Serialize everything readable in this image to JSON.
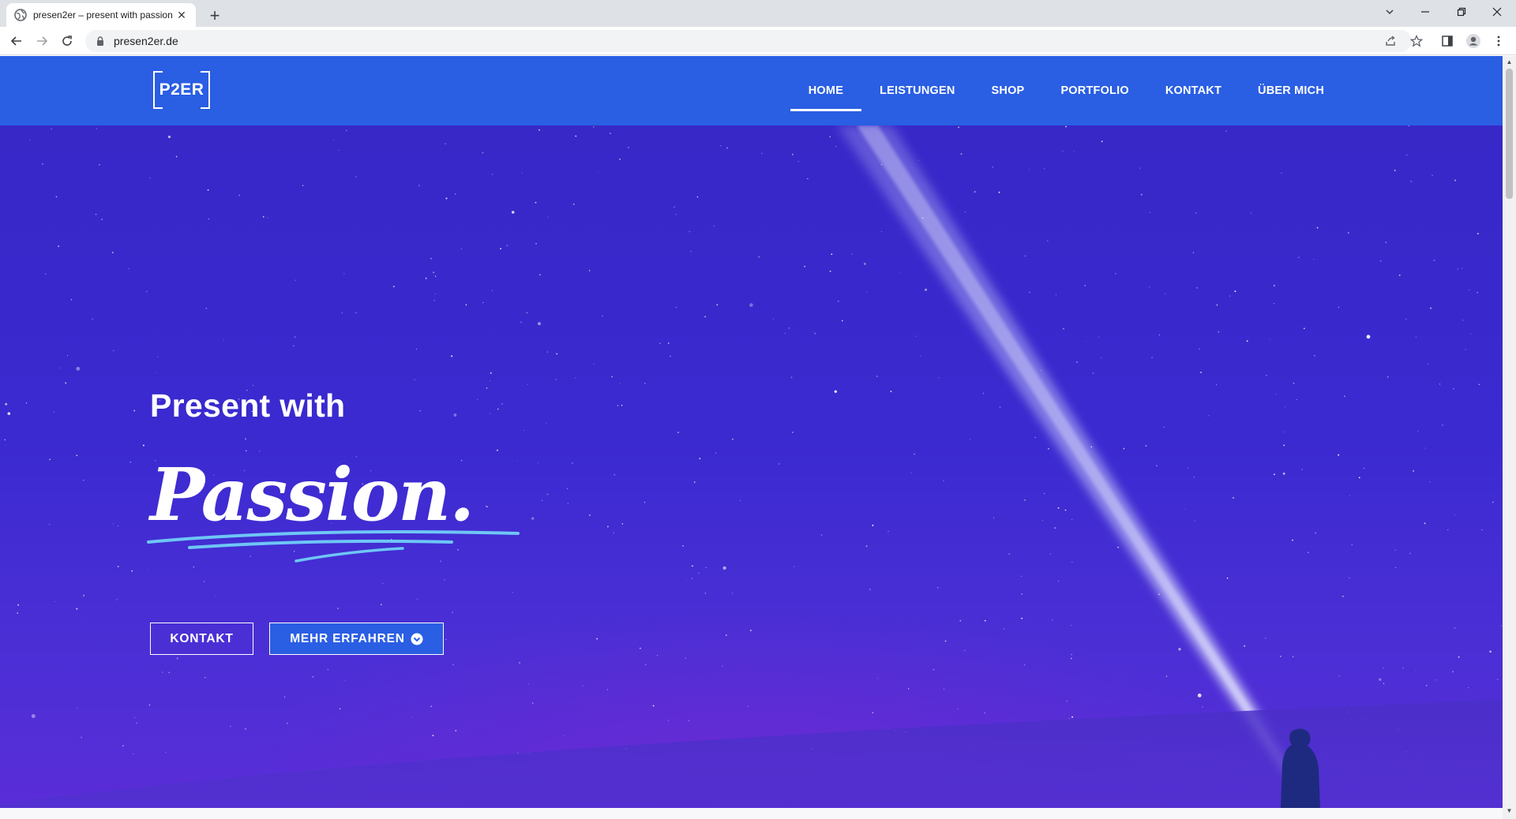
{
  "browser": {
    "tab_title": "presen2er – present with passion",
    "url": "presen2er.de"
  },
  "site": {
    "logo_text": "P2ER",
    "nav": [
      {
        "label": "HOME",
        "active": true
      },
      {
        "label": "LEISTUNGEN",
        "active": false
      },
      {
        "label": "SHOP",
        "active": false
      },
      {
        "label": "PORTFOLIO",
        "active": false
      },
      {
        "label": "KONTAKT",
        "active": false
      },
      {
        "label": "ÜBER MICH",
        "active": false
      }
    ],
    "accent_color": "#2a5ee3"
  },
  "hero": {
    "title": "Present with",
    "script_word": "Passion.",
    "buttons": {
      "contact": "KONTAKT",
      "more": "MEHR ERFAHREN"
    }
  }
}
